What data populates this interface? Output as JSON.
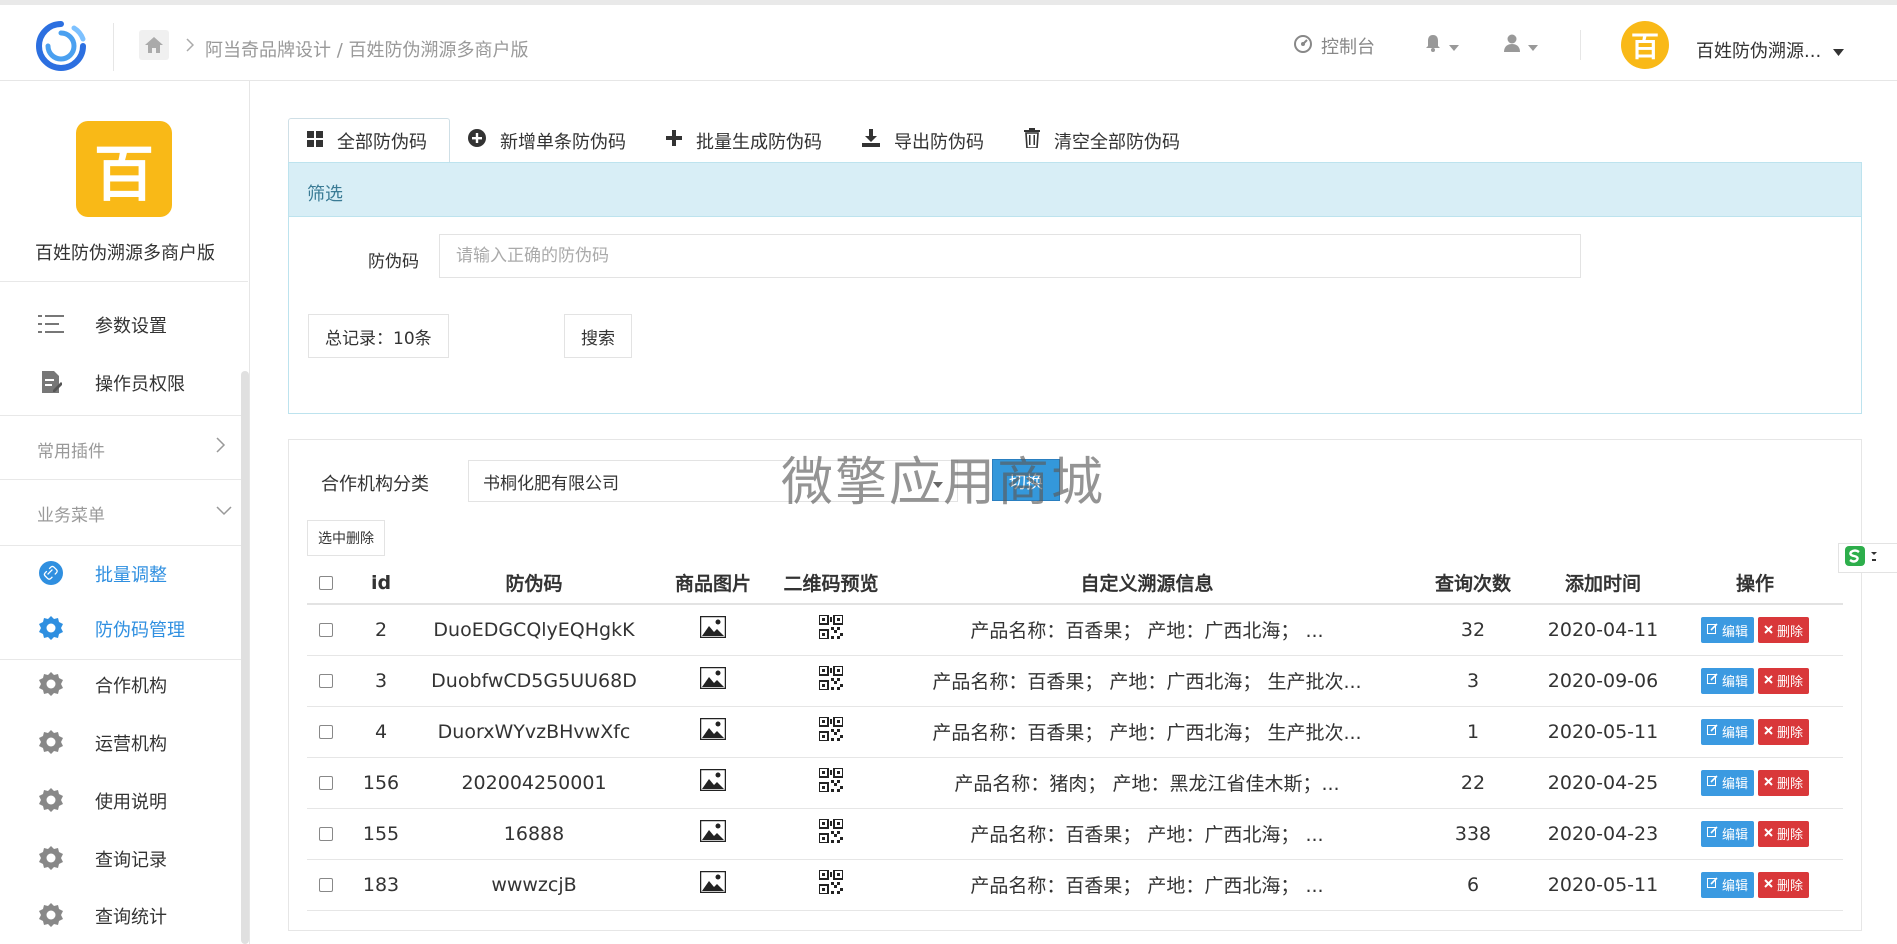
{
  "header": {
    "breadcrumb": "阿当奇品牌设计 / 百姓防伪溯源多商户版",
    "console_label": "控制台",
    "user_name": "百姓防伪溯源...",
    "avatar_char": "百"
  },
  "sidebar": {
    "logo_char": "百",
    "brand": "百姓防伪溯源多商户版",
    "top_items": [
      {
        "label": "参数设置",
        "icon": "list-icon"
      },
      {
        "label": "操作员权限",
        "icon": "document-edit-icon"
      }
    ],
    "sections": [
      {
        "label": "常用插件"
      },
      {
        "label": "业务菜单"
      }
    ],
    "business_items": [
      {
        "label": "批量调整",
        "icon": "link-icon",
        "active": true
      },
      {
        "label": "防伪码管理",
        "icon": "gear-icon",
        "active": true
      },
      {
        "label": "合作机构",
        "icon": "gear-icon"
      },
      {
        "label": "运营机构",
        "icon": "gear-icon"
      },
      {
        "label": "使用说明",
        "icon": "gear-icon"
      },
      {
        "label": "查询记录",
        "icon": "gear-icon"
      },
      {
        "label": "查询统计",
        "icon": "gear-icon"
      }
    ]
  },
  "tabs": [
    {
      "label": "全部防伪码",
      "icon": "grid-icon"
    },
    {
      "label": "新增单条防伪码",
      "icon": "plus-circle-icon"
    },
    {
      "label": "批量生成防伪码",
      "icon": "plus-icon"
    },
    {
      "label": "导出防伪码",
      "icon": "download-icon"
    },
    {
      "label": "清空全部防伪码",
      "icon": "trash-icon"
    }
  ],
  "filter": {
    "title": "筛选",
    "code_label": "防伪码",
    "code_placeholder": "请输入正确的防伪码",
    "total": "总记录：10条",
    "search_label": "搜索"
  },
  "list": {
    "org_label": "合作机构分类",
    "org_selected": "书桐化肥有限公司",
    "switch_label": "切换",
    "watermark": "微擎应用商城",
    "delete_selected": "选中删除",
    "columns": [
      "id",
      "防伪码",
      "商品图片",
      "二维码预览",
      "自定义溯源信息",
      "查询次数",
      "添加时间",
      "操作"
    ],
    "edit_label": "编辑",
    "delete_label": "删除",
    "rows": [
      {
        "id": "2",
        "code": "DuoEDGCQlyEQHgkK",
        "info": "产品名称：百香果；  产地：广西北海；  ...",
        "count": "32",
        "date": "2020-04-11"
      },
      {
        "id": "3",
        "code": "DuobfwCD5G5UU68D",
        "info": "产品名称：百香果；  产地：广西北海；  生产批次...",
        "count": "3",
        "date": "2020-09-06"
      },
      {
        "id": "4",
        "code": "DuorxWYvzBHvwXfc",
        "info": "产品名称：百香果；  产地：广西北海；  生产批次...",
        "count": "1",
        "date": "2020-05-11"
      },
      {
        "id": "156",
        "code": "202004250001",
        "info": "产品名称：猪肉；  产地：黑龙江省佳木斯；...",
        "count": "22",
        "date": "2020-04-25"
      },
      {
        "id": "155",
        "code": "16888",
        "info": "产品名称：百香果；  产地：广西北海；  ...",
        "count": "338",
        "date": "2020-04-23"
      },
      {
        "id": "183",
        "code": "wwwzcjB",
        "info": "产品名称：百香果；  产地：广西北海；  ...",
        "count": "6",
        "date": "2020-05-11"
      }
    ]
  },
  "colors": {
    "accent": "#2f8fe0",
    "brand_yellow": "#f9b917",
    "edit_blue": "#3b9ae1",
    "delete_red": "#d9383a",
    "filter_head": "#d8eef6"
  }
}
